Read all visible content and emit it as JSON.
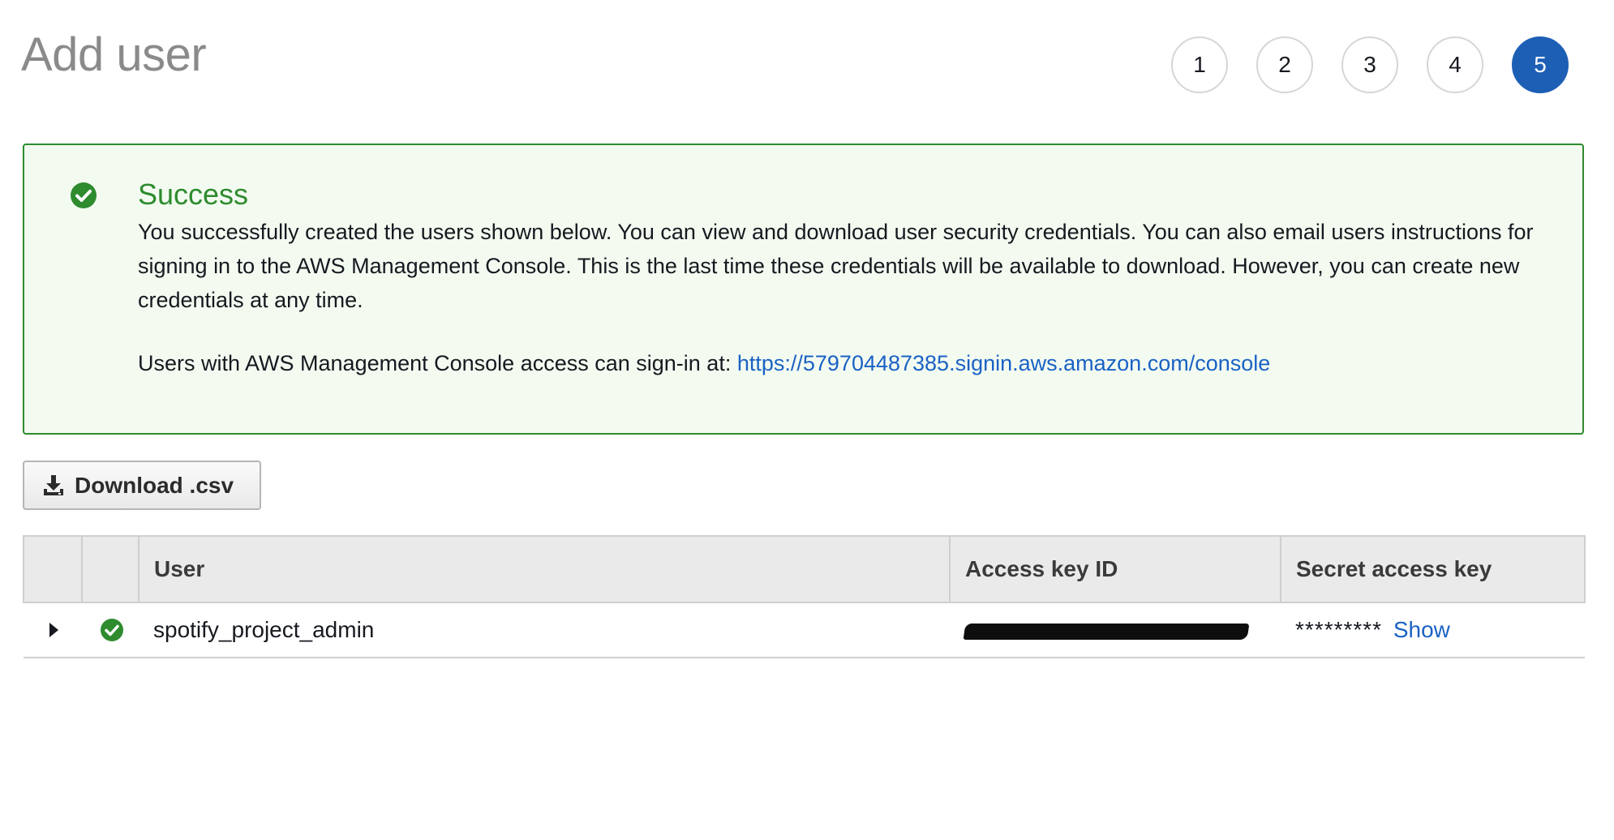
{
  "page": {
    "title": "Add user"
  },
  "steps": [
    {
      "label": "1",
      "active": false
    },
    {
      "label": "2",
      "active": false
    },
    {
      "label": "3",
      "active": false
    },
    {
      "label": "4",
      "active": false
    },
    {
      "label": "5",
      "active": true
    }
  ],
  "alert": {
    "icon": "check-circle-icon",
    "title": "Success",
    "body": "You successfully created the users shown below. You can view and download user security credentials. You can also email users instructions for signing in to the AWS Management Console. This is the last time these credentials will be available to download. However, you can create new credentials at any time.",
    "signin_prefix": "Users with AWS Management Console access can sign-in at:",
    "signin_url": "https://579704487385.signin.aws.amazon.com/console"
  },
  "download": {
    "icon": "download-icon",
    "label": "Download .csv"
  },
  "table": {
    "headers": {
      "user": "User",
      "access_key_id": "Access key ID",
      "secret_access_key": "Secret access key"
    },
    "rows": [
      {
        "user": "spotify_project_admin",
        "access_key_id_redacted": true,
        "secret_masked": "*********",
        "secret_show_label": "Show"
      }
    ]
  },
  "colors": {
    "success": "#2e8b2e",
    "link": "#1a62c4",
    "active_step": "#1d5fb4"
  }
}
